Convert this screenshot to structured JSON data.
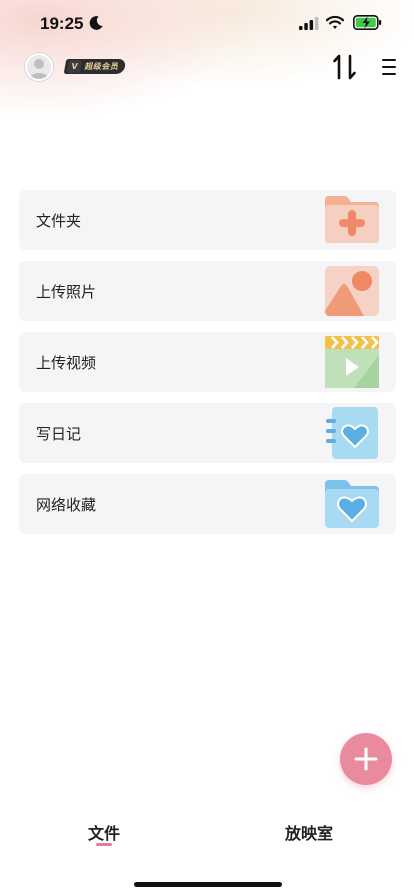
{
  "status_bar": {
    "time": "19:25",
    "icons": [
      "moon-icon",
      "cellular-signal-icon",
      "wifi-icon",
      "battery-charging-icon"
    ]
  },
  "header": {
    "avatar_icon": "user-avatar",
    "vip_badge": {
      "letter": "V",
      "label": "超级会员"
    },
    "sort_icon": "sort-arrows-icon",
    "menu_icon": "hamburger-menu-icon"
  },
  "items": [
    {
      "label": "文件夹",
      "icon": "folder-add-icon"
    },
    {
      "label": "上传照片",
      "icon": "photo-upload-icon"
    },
    {
      "label": "上传视频",
      "icon": "video-upload-icon"
    },
    {
      "label": "写日记",
      "icon": "diary-heart-icon"
    },
    {
      "label": "网络收藏",
      "icon": "heart-folder-icon"
    }
  ],
  "fab": {
    "icon": "plus-icon"
  },
  "tabs": [
    {
      "label": "文件",
      "active": true
    },
    {
      "label": "放映室",
      "active": false
    }
  ],
  "colors": {
    "accent": "#ea8a9f",
    "card_bg": "#f5f5f7",
    "folder_orange": "#f09a78",
    "video_green": "#b9dbb5",
    "video_yellow": "#f3c14a",
    "diary_blue": "#8fd0ee",
    "heart_blue": "#5aaee2"
  }
}
